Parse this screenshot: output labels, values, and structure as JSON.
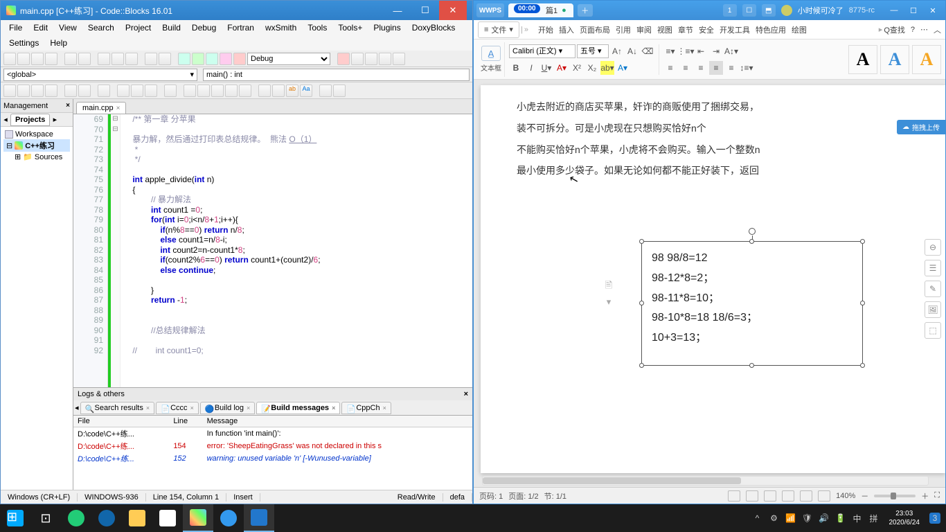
{
  "codeblocks": {
    "title": "main.cpp [C++练习] - Code::Blocks 16.01",
    "menus": [
      "File",
      "Edit",
      "View",
      "Search",
      "Project",
      "Build",
      "Debug",
      "Fortran",
      "wxSmith",
      "Tools",
      "Tools+",
      "Plugins",
      "DoxyBlocks"
    ],
    "menus2": [
      "Settings",
      "Help"
    ],
    "build_target": "Debug",
    "scope": "<global>",
    "function": "main() : int",
    "mgmt_title": "Management",
    "mgmt_tab": "Projects",
    "workspace": "Workspace",
    "project": "C++练习",
    "sources_folder": "Sources",
    "editor_tab": "main.cpp",
    "code_start_line": 69,
    "code_lines": [
      {
        "n": 69,
        "html": "<span class='c-com'>/** 第一章 分苹果</span>"
      },
      {
        "n": 70,
        "html": ""
      },
      {
        "n": 71,
        "html": "<span class='c-com'>暴力解，然后通过打印表总结规律。  熊法 <u>O（1）</u></span>"
      },
      {
        "n": 72,
        "html": "<span class='c-com'> *</span>"
      },
      {
        "n": 73,
        "html": "<span class='c-com'> */</span>"
      },
      {
        "n": 74,
        "html": ""
      },
      {
        "n": 75,
        "html": "<span class='c-kw'>int</span> apple_divide(<span class='c-kw'>int</span> n)"
      },
      {
        "n": 76,
        "html": "{",
        "fold": "⊟"
      },
      {
        "n": 77,
        "html": "        <span class='c-com'>// 暴力解法</span>"
      },
      {
        "n": 78,
        "html": "        <span class='c-kw'>int</span> count1 =<span class='c-num'>0</span>;"
      },
      {
        "n": 79,
        "html": "        <span class='c-kw'>for</span>(<span class='c-kw'>int</span> i=<span class='c-num'>0</span>;i&lt;n/<span class='c-num'>8</span>+<span class='c-num'>1</span>;i++){",
        "fold": "⊟"
      },
      {
        "n": 80,
        "html": "            <span class='c-kw'>if</span>(n%<span class='c-num'>8</span>==<span class='c-num'>0</span>) <span class='c-kw'>return</span> n/<span class='c-num'>8</span>;"
      },
      {
        "n": 81,
        "html": "            <span class='c-kw'>else</span> count1=n/<span class='c-num'>8</span>-i;"
      },
      {
        "n": 82,
        "html": "            <span class='c-kw'>int</span> count2=n-count1*<span class='c-num'>8</span>;"
      },
      {
        "n": 83,
        "html": "            <span class='c-kw'>if</span>(count2%<span class='c-num'>6</span>==<span class='c-num'>0</span>) <span class='c-kw'>return</span> count1+(count2)/<span class='c-num'>6</span>;"
      },
      {
        "n": 84,
        "html": "            <span class='c-kw'>else</span> <span class='c-kw'>continue</span>;"
      },
      {
        "n": 85,
        "html": ""
      },
      {
        "n": 86,
        "html": "        }"
      },
      {
        "n": 87,
        "html": "        <span class='c-kw'>return</span> -<span class='c-num'>1</span>;"
      },
      {
        "n": 88,
        "html": ""
      },
      {
        "n": 89,
        "html": ""
      },
      {
        "n": 90,
        "html": "        <span class='c-com'>//总结规律解法</span>"
      },
      {
        "n": 91,
        "html": ""
      },
      {
        "n": 92,
        "html": "<span class='c-com'>//        int count1=0;</span>"
      }
    ],
    "logs_title": "Logs & others",
    "logs_tabs": [
      {
        "label": "Search results",
        "icon": "🔍",
        "active": false
      },
      {
        "label": "Cccc",
        "icon": "📄",
        "active": false
      },
      {
        "label": "Build log",
        "icon": "🔵",
        "active": false
      },
      {
        "label": "Build messages",
        "icon": "📝",
        "active": true
      },
      {
        "label": "CppCh",
        "icon": "📄",
        "active": false
      }
    ],
    "logs_cols": [
      "File",
      "Line",
      "Message"
    ],
    "logs_rows": [
      {
        "file": "D:\\code\\C++练...",
        "line": "",
        "msg": "In function 'int main()':",
        "cls": ""
      },
      {
        "file": "D:\\code\\C++练...",
        "line": "154",
        "msg": "error: 'SheepEatingGrass' was not declared in this s",
        "cls": "err"
      },
      {
        "file": "D:\\code\\C++练...",
        "line": "152",
        "msg": "warning: unused variable 'n' [-Wunused-variable]",
        "cls": "warn"
      }
    ],
    "status": {
      "eol": "Windows (CR+LF)",
      "encoding": "WINDOWS-936",
      "pos": "Line 154, Column 1",
      "mode": "Insert",
      "rw": "Read/Write",
      "lang": "defa"
    }
  },
  "wps": {
    "brand": "WPS",
    "timer": "00:00",
    "doc_tab": "篇1",
    "user": "小时候可冷了",
    "user_id": "8775-rc",
    "quick_access_count": "1",
    "file_menu": "文件",
    "tabs": [
      "开始",
      "插入",
      "页面布局",
      "引用",
      "审阅",
      "视图",
      "章节",
      "安全",
      "开发工具",
      "特色应用",
      "绘图"
    ],
    "search": "Q查找",
    "textbox_label": "文本框",
    "font": "Calibri (正文)",
    "fontsize": "五号",
    "upload": "拖拽上传",
    "paragraphs": [
      "小虎去附近的商店买苹果，奸诈的商贩使用了捆绑交易，",
      "装不可拆分。可是小虎现在只想购买恰好n个",
      "不能购买恰好n个苹果，小虎将不会购买。输入一个整数n",
      "最小使用多少袋子。如果无论如何都不能正好装下，返回"
    ],
    "textbox_lines": [
      "98 98/8=12",
      "  98-12*8=2；",
      "   98-11*8=10；",
      "98-10*8=18   18/6=3；",
      "10+3=13；"
    ],
    "status": {
      "page_code": "页码: 1",
      "page": "页面: 1/2",
      "section": "节: 1/1",
      "zoom": "140%"
    }
  },
  "taskbar": {
    "time": "23:03",
    "date": "2020/6/24",
    "tray": [
      "^",
      "⚙",
      "📶",
      "🛡",
      "🔊",
      "🔋",
      "中",
      "拼"
    ],
    "notif": "3"
  }
}
